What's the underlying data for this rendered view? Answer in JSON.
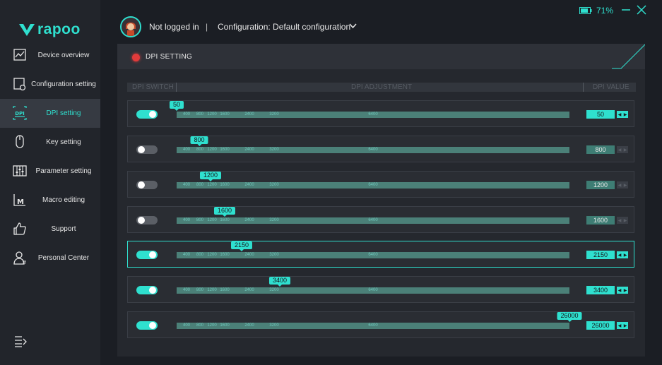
{
  "app": {
    "brand": "rapoo",
    "accent": "#2fe0cf"
  },
  "sidebar": {
    "items": [
      {
        "label": "Device overview",
        "icon": "chart-icon"
      },
      {
        "label": "Configuration setting",
        "icon": "config-icon"
      },
      {
        "label": "DPI setting",
        "icon": "dpi-icon",
        "active": true
      },
      {
        "label": "Key setting",
        "icon": "mouse-icon"
      },
      {
        "label": "Parameter setting",
        "icon": "sliders-icon"
      },
      {
        "label": "Macro editing",
        "icon": "macro-icon"
      },
      {
        "label": "Support",
        "icon": "thumbs-up-icon"
      },
      {
        "label": "Personal Center",
        "icon": "user-icon"
      }
    ]
  },
  "header": {
    "battery": "71%",
    "login_status": "Not logged in",
    "separator": "|",
    "configuration": "Configuration: Default configuration"
  },
  "dpi_panel": {
    "title": "DPI SETTING",
    "columns": {
      "switch": "DPI SWITCH",
      "adjust": "DPI ADJUSTMENT",
      "value": "DPI VALUE"
    },
    "ticks": [
      "400",
      "800",
      "1200",
      "1600",
      "2400",
      "3200",
      "6400"
    ],
    "rows": [
      {
        "enabled": true,
        "value": "50"
      },
      {
        "enabled": false,
        "value": "800"
      },
      {
        "enabled": false,
        "value": "1200"
      },
      {
        "enabled": false,
        "value": "1600"
      },
      {
        "enabled": true,
        "value": "2150",
        "selected": true
      },
      {
        "enabled": true,
        "value": "3400"
      },
      {
        "enabled": true,
        "value": "26000"
      }
    ]
  }
}
